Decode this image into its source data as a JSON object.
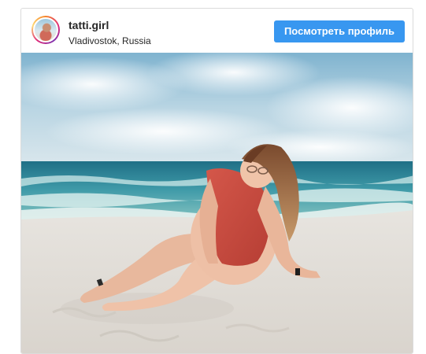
{
  "post": {
    "username": "tatti.girl",
    "location": "Vladivostok, Russia",
    "profile_button_label": "Посмотреть профиль",
    "accent_color": "#3897f0"
  },
  "photo": {
    "subject": "beach-photo"
  }
}
